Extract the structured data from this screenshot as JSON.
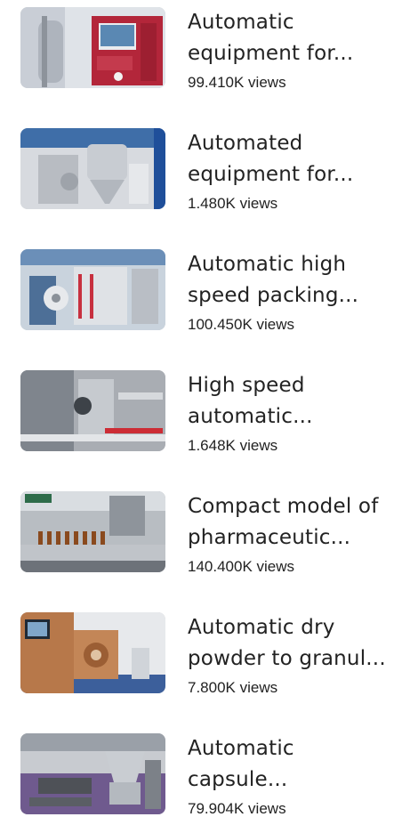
{
  "videos": [
    {
      "title": "Automatic equipment for...",
      "views": "99.410K views",
      "thumb_icon": "bioreactor-thumbnail"
    },
    {
      "title": "Automated equipment for...",
      "views": "1.480K views",
      "thumb_icon": "spray-dryer-thumbnail"
    },
    {
      "title": "Automatic high speed packing...",
      "views": "100.450K views",
      "thumb_icon": "packing-machine-thumbnail"
    },
    {
      "title": "High speed automatic...",
      "views": "1.648K views",
      "thumb_icon": "filling-machine-thumbnail"
    },
    {
      "title": "Compact model of pharmaceutic...",
      "views": "140.400K views",
      "thumb_icon": "vial-line-thumbnail"
    },
    {
      "title": "Automatic dry powder to granul...",
      "views": "7.800K views",
      "thumb_icon": "granulator-thumbnail"
    },
    {
      "title": "Automatic capsule...",
      "views": "79.904K views",
      "thumb_icon": "capsule-filler-thumbnail"
    }
  ],
  "colors": {
    "text": "#222222",
    "thumb_red": "#b3263a",
    "thumb_steel": "#a9adb3",
    "thumb_blue": "#1f4f9a",
    "thumb_copper": "#b7784a",
    "thumb_purple": "#6f5a8e"
  }
}
